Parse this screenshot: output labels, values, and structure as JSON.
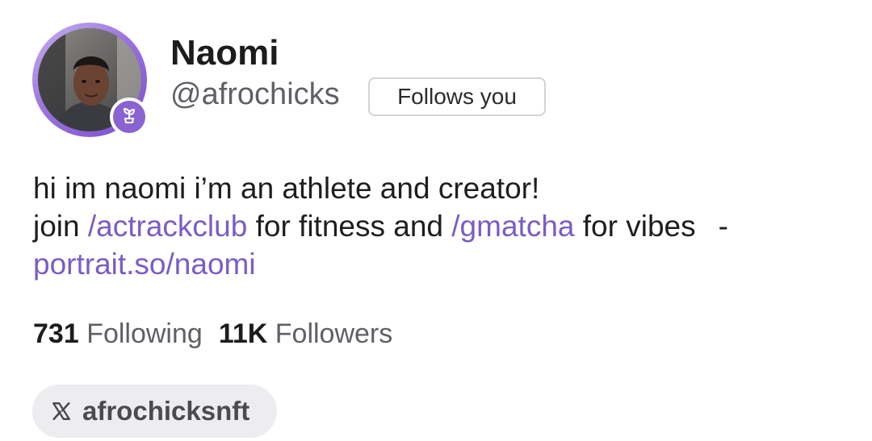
{
  "profile": {
    "display_name": "Naomi",
    "handle": "@afrochicks",
    "follows_you_label": "Follows you",
    "bio": {
      "line1": "hi im naomi i’m an athlete and creator!",
      "line2_prefix": "join ",
      "channel1": "/actrackclub",
      "line2_mid": " for fitness and ",
      "channel2": "/gmatcha",
      "line2_suffix": " for vibes",
      "dash": "-",
      "link": "portrait.so/naomi"
    },
    "stats": {
      "following_count": "731",
      "following_label": "Following",
      "followers_count": "11K",
      "followers_label": "Followers"
    },
    "social": {
      "icon": "x-logo-icon",
      "label": "afrochicksnft"
    },
    "badge_icon": "sprout-icon",
    "colors": {
      "accent": "#8a63d2",
      "link": "#7a5cc7",
      "chip_bg": "#ededf0"
    }
  }
}
